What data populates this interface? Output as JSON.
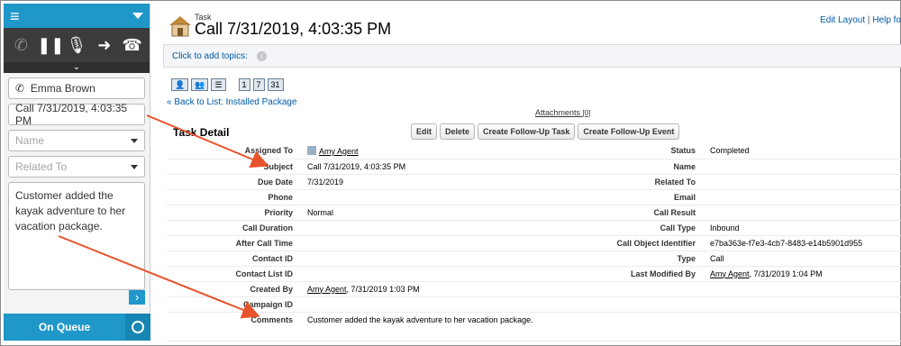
{
  "softphone": {
    "contact": "Emma Brown",
    "call_subject": "Call 7/31/2019, 4:03:35 PM",
    "name_placeholder": "Name",
    "related_placeholder": "Related To",
    "notes": "Customer added the kayak adventure to her vacation package.",
    "status": "On Queue",
    "accent": "#1f97c8"
  },
  "header": {
    "object_type": "Task",
    "title": "Call 7/31/2019, 4:03:35 PM",
    "edit_layout": "Edit Layout",
    "sep": "|",
    "help": "Help fo"
  },
  "topics": {
    "label": "Click to add topics:"
  },
  "views": [
    "1",
    "7",
    "31"
  ],
  "back_link": "« Back to List: Installed Package",
  "attachments": {
    "label": "Attachments",
    "count": "[0]"
  },
  "detail": {
    "title": "Task Detail",
    "buttons": [
      "Edit",
      "Delete",
      "Create Follow-Up Task",
      "Create Follow-Up Event"
    ],
    "rows": [
      {
        "l1": "Assigned To",
        "v1": "Amy Agent",
        "l2": "Status",
        "v2": "Completed"
      },
      {
        "l1": "Subject",
        "v1": "Call 7/31/2019, 4:03:35 PM",
        "l2": "Name",
        "v2": ""
      },
      {
        "l1": "Due Date",
        "v1": "7/31/2019",
        "l2": "Related To",
        "v2": ""
      },
      {
        "l1": "Phone",
        "v1": "",
        "l2": "Email",
        "v2": ""
      },
      {
        "l1": "Priority",
        "v1": "Normal",
        "l2": "Call Result",
        "v2": ""
      },
      {
        "l1": "Call Duration",
        "v1": "",
        "l2": "Call Type",
        "v2": "Inbound"
      },
      {
        "l1": "After Call Time",
        "v1": "",
        "l2": "Call Object Identifier",
        "v2": "e7ba363e-f7e3-4cb7-8483-e14b5901d955"
      },
      {
        "l1": "Contact ID",
        "v1": "",
        "l2": "Type",
        "v2": "Call"
      },
      {
        "l1": "Contact List ID",
        "v1": "",
        "l2": "Last Modified By",
        "v2_link": "Amy Agent",
        "v2": ", 7/31/2019 1:04 PM"
      },
      {
        "l1": "Created By",
        "v1_link": "Amy Agent",
        "v1": ", 7/31/2019 1:03 PM",
        "l2": "",
        "v2": ""
      },
      {
        "l1": "Campaign ID",
        "v1": "",
        "l2": "",
        "v2": ""
      },
      {
        "l1": "Comments",
        "v1": "Customer added the kayak adventure to her vacation package.",
        "l2": "",
        "v2": ""
      }
    ]
  }
}
